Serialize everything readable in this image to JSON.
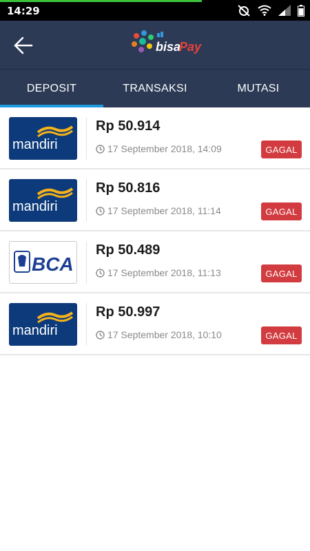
{
  "status_bar": {
    "time": "14:29",
    "icons": [
      "alarm-off-icon",
      "wifi-icon",
      "signal-icon",
      "battery-icon"
    ]
  },
  "app_bar": {
    "back_icon": "arrow-left-icon",
    "logo_text": "bisaPay"
  },
  "tabs": [
    {
      "label": "DEPOSIT",
      "active": true
    },
    {
      "label": "TRANSAKSI",
      "active": false
    },
    {
      "label": "MUTASI",
      "active": false
    }
  ],
  "deposits": [
    {
      "bank": "mandiri",
      "amount": "Rp 50.914",
      "date": "17 September 2018, 14:09",
      "status": "GAGAL"
    },
    {
      "bank": "mandiri",
      "amount": "Rp 50.816",
      "date": "17 September 2018, 11:14",
      "status": "GAGAL"
    },
    {
      "bank": "BCA",
      "amount": "Rp 50.489",
      "date": "17 September 2018, 11:13",
      "status": "GAGAL"
    },
    {
      "bank": "mandiri",
      "amount": "Rp 50.997",
      "date": "17 September 2018, 10:10",
      "status": "GAGAL"
    }
  ],
  "colors": {
    "app_bar": "#2c3a55",
    "tab_indicator": "#1e9be0",
    "status_failed": "#d23b3f",
    "mandiri_blue": "#0c3a7a",
    "mandiri_yellow": "#f5b21a",
    "bca_blue": "#1c3f95"
  }
}
